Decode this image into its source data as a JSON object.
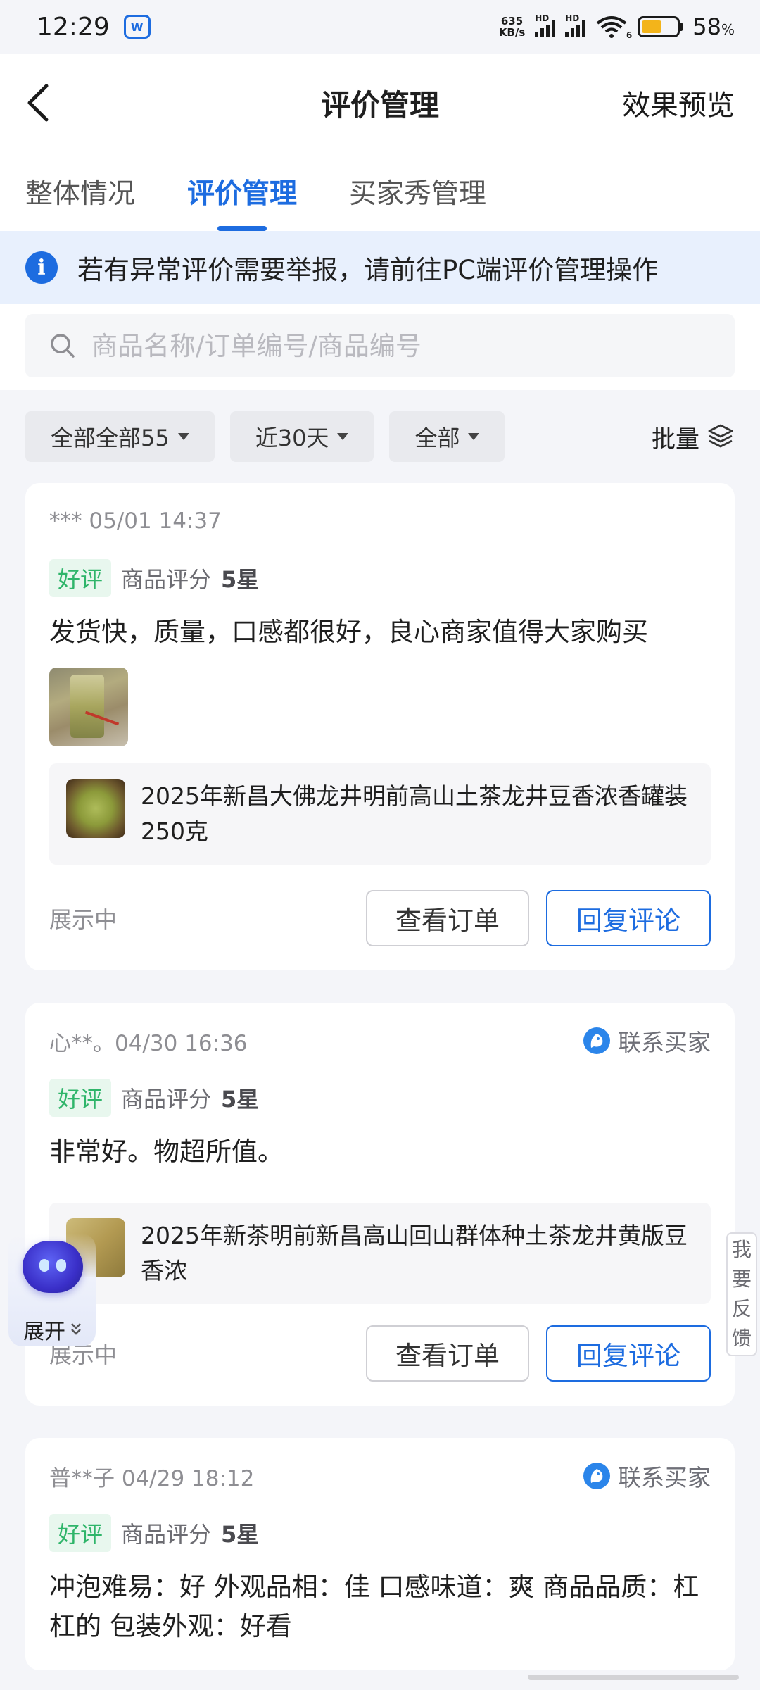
{
  "status_bar": {
    "time": "12:29",
    "net_speed_value": "635",
    "net_speed_unit": "KB/s",
    "signal_badge": "HD",
    "wifi_badge": "6",
    "battery_percent": 58,
    "battery_text": "58",
    "battery_unit": "%"
  },
  "header": {
    "title": "评价管理",
    "preview_label": "效果预览"
  },
  "tabs": [
    {
      "label": "整体情况",
      "active": false
    },
    {
      "label": "评价管理",
      "active": true
    },
    {
      "label": "买家秀管理",
      "active": false
    }
  ],
  "notice": {
    "icon": "info-icon",
    "text": "若有异常评价需要举报，请前往PC端评价管理操作"
  },
  "search": {
    "placeholder": "商品名称/订单编号/商品编号",
    "value": ""
  },
  "filters": {
    "type": "全部全部55",
    "period": "近30天",
    "scope": "全部",
    "batch_label": "批量"
  },
  "reviews": [
    {
      "user_time": "*** 05/01 14:37",
      "contact_label": "",
      "badge": "好评",
      "rating_label": "商品评分",
      "rating_value": "5星",
      "text": "发货快，质量，口感都很好，良心商家值得大家购买",
      "product_name": "2025年新昌大佛龙井明前高山土茶龙井豆香浓香罐装250克",
      "status": "展示中",
      "order_btn": "查看订单",
      "reply_btn": "回复评论"
    },
    {
      "user_time": "心**。04/30 16:36",
      "contact_label": "联系买家",
      "badge": "好评",
      "rating_label": "商品评分",
      "rating_value": "5星",
      "text": "非常好。物超所值。",
      "product_name": "2025年新茶明前新昌高山回山群体种土茶龙井黄版豆香浓",
      "status": "展示中",
      "order_btn": "查看订单",
      "reply_btn": "回复评论"
    },
    {
      "user_time": "普**子 04/29 18:12",
      "contact_label": "联系买家",
      "badge": "好评",
      "rating_label": "商品评分",
      "rating_value": "5星",
      "text": "冲泡难易：好 外观品相：佳 口感味道：爽 商品品质：杠杠的 包装外观：好看"
    }
  ],
  "assistant": {
    "expand_label": "展开"
  },
  "feedback": {
    "chars": [
      "我",
      "要",
      "反",
      "馈"
    ]
  },
  "colors": {
    "accent": "#1d6ce0",
    "good_badge_text": "#2fb56a",
    "good_badge_bg": "#e8f7ee",
    "page_bg": "#f4f5f9",
    "notice_bg": "#e8f0fd"
  }
}
